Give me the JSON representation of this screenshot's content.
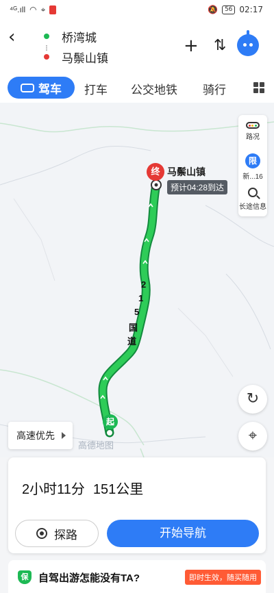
{
  "status_bar": {
    "signal": "⁴ᴳ.ıll",
    "time": "02:17",
    "battery": "56"
  },
  "route": {
    "origin": "桥湾城",
    "destination": "马鬃山镇"
  },
  "header": {
    "back_icon": "back-arrow-icon",
    "add_icon": "plus-icon",
    "swap_icon": "swap-icon",
    "assistant_icon": "robot-assistant-icon"
  },
  "tabs": {
    "active": "驾车",
    "items": [
      "打车",
      "公交地铁",
      "骑行"
    ]
  },
  "map": {
    "destination_marker": "终",
    "destination_label": "马鬃山镇",
    "eta": "预计04:28到达",
    "start_marker": "起",
    "road_name_chars": [
      "2",
      "1",
      "5",
      "国",
      "道"
    ],
    "logo": "高德地图",
    "side_panel": {
      "traffic_label": "路况",
      "limit_icon": "限",
      "limit_label": "新...16",
      "longtrip_label": "长途信息"
    },
    "preference": "高速优先",
    "colors": {
      "route": "#1db954",
      "route_outline": "#138a3e"
    }
  },
  "summary": {
    "duration": "2小时11分",
    "distance": "151公里"
  },
  "buttons": {
    "explore": "探路",
    "start_nav": "开始导航"
  },
  "promo": {
    "icon": "保",
    "text": "自驾出游怎能没有TA?",
    "tag": "即时生效，随买随用"
  },
  "colors": {
    "accent": "#2e7cf6",
    "start": "#1db954",
    "end": "#e53935"
  }
}
